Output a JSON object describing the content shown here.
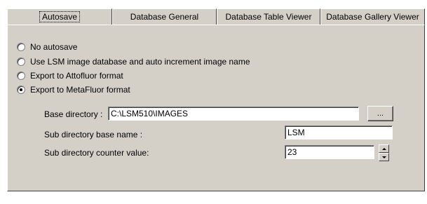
{
  "tabs": [
    {
      "label": "Autosave",
      "active": true
    },
    {
      "label": "Database General",
      "active": false
    },
    {
      "label": "Database Table Viewer",
      "active": false
    },
    {
      "label": "Database Gallery Viewer",
      "active": false
    }
  ],
  "autosave": {
    "options": [
      {
        "label": "No autosave",
        "checked": false
      },
      {
        "label": "Use LSM image database and auto increment image name",
        "checked": false
      },
      {
        "label": "Export to Attofluor format",
        "checked": false
      },
      {
        "label": "Export to MetaFluor format",
        "checked": true
      }
    ],
    "base_directory": {
      "label": "Base directory :",
      "value": "C:\\LSM510\\IMAGES",
      "browse_label": "..."
    },
    "sub_directory_base_name": {
      "label": "Sub directory base name :",
      "value": "LSM"
    },
    "sub_directory_counter": {
      "label": "Sub directory counter value:",
      "value": "23"
    }
  }
}
